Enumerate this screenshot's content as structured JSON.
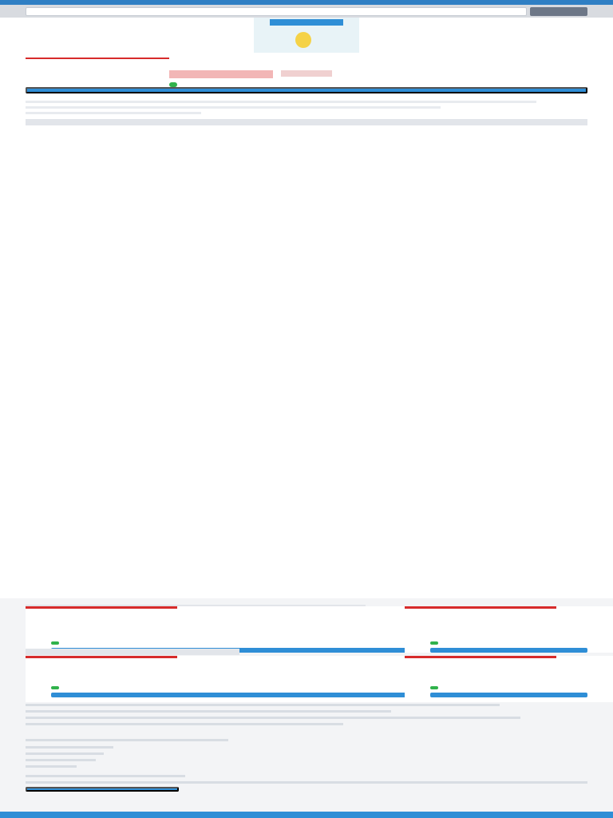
{
  "search": {
    "placeholder": ""
  },
  "product": {
    "title": "",
    "price": "",
    "availability": ""
  },
  "page": {
    "section_title": ""
  },
  "product_list": [],
  "related": {
    "title": ""
  },
  "viewed": {
    "title": ""
  },
  "footer": {
    "links": []
  },
  "colors": {
    "accent": "#2f8ed6",
    "sale": "#d72b2b",
    "available": "#30b24b",
    "topbar": "#d8dbe0"
  }
}
